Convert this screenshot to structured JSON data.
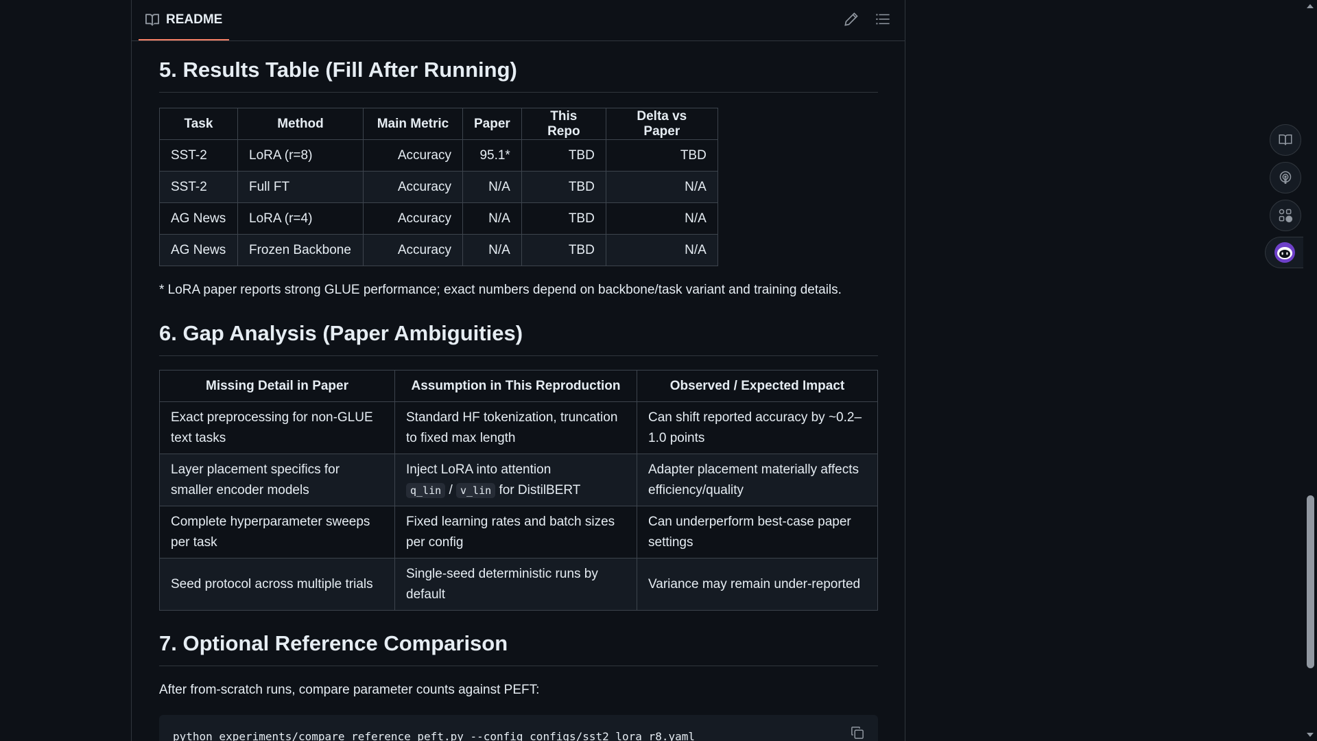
{
  "readme": {
    "tab_label": "README",
    "edit_icon": "pencil-icon",
    "outline_icon": "list-icon"
  },
  "section5": {
    "heading": "5. Results Table (Fill After Running)",
    "headers": [
      "Task",
      "Method",
      "Main Metric",
      "Paper",
      "This Repo",
      "Delta vs Paper"
    ],
    "rows": [
      [
        "SST-2",
        "LoRA (r=8)",
        "Accuracy",
        "95.1*",
        "TBD",
        "TBD"
      ],
      [
        "SST-2",
        "Full FT",
        "Accuracy",
        "N/A",
        "TBD",
        "N/A"
      ],
      [
        "AG News",
        "LoRA (r=4)",
        "Accuracy",
        "N/A",
        "TBD",
        "N/A"
      ],
      [
        "AG News",
        "Frozen Backbone",
        "Accuracy",
        "N/A",
        "TBD",
        "N/A"
      ]
    ],
    "footnote": "* LoRA paper reports strong GLUE performance; exact numbers depend on backbone/task variant and training details."
  },
  "section6": {
    "heading": "6. Gap Analysis (Paper Ambiguities)",
    "headers": [
      "Missing Detail in Paper",
      "Assumption in This Reproduction",
      "Observed / Expected Impact"
    ],
    "rows": [
      {
        "missing": "Exact preprocessing for non-GLUE text tasks",
        "assumption": "Standard HF tokenization, truncation to fixed max length",
        "impact": "Can shift reported accuracy by ~0.2–1.0 points"
      },
      {
        "missing": "Layer placement specifics for smaller encoder models",
        "assumption_pre": "Inject LoRA into attention",
        "code1": "q_lin",
        "sep": "/",
        "code2": "v_lin",
        "assumption_post": "for DistilBERT",
        "impact": "Adapter placement materially affects efficiency/quality"
      },
      {
        "missing": "Complete hyperparameter sweeps per task",
        "assumption": "Fixed learning rates and batch sizes per config",
        "impact": "Can underperform best-case paper settings"
      },
      {
        "missing": "Seed protocol across multiple trials",
        "assumption": "Single-seed deterministic runs by default",
        "impact": "Variance may remain under-reported"
      }
    ]
  },
  "section7": {
    "heading": "7. Optional Reference Comparison",
    "paragraph": "After from-scratch runs, compare parameter counts against PEFT:",
    "code": "python experiments/compare_reference_peft.py --config configs/sst2_lora_r8.yaml",
    "copy_icon": "copy-icon"
  },
  "sidebar_buttons": [
    "book-icon",
    "podcast-icon",
    "apps-github-icon",
    "copilot-icon"
  ],
  "colors": {
    "background": "#0d1117",
    "text": "#e6edf3",
    "border": "#30363d",
    "tab_accent": "#f78166",
    "code_background": "#151b23",
    "copilot_accent": "#8250df"
  }
}
